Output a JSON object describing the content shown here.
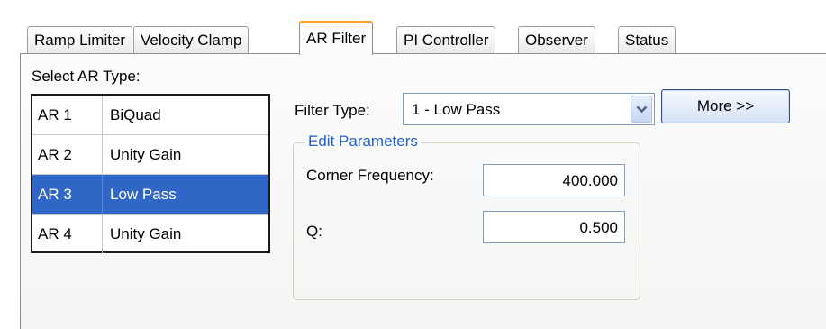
{
  "tabs": [
    {
      "label": "Ramp Limiter"
    },
    {
      "label": "Velocity Clamp"
    },
    {
      "label": "AR Filter"
    },
    {
      "label": "PI Controller"
    },
    {
      "label": "Observer"
    },
    {
      "label": "Status"
    }
  ],
  "active_tab": "AR Filter",
  "select_label": "Select AR Type:",
  "ar_list": {
    "rows": [
      {
        "id": "AR 1",
        "type": "BiQuad"
      },
      {
        "id": "AR 2",
        "type": "Unity Gain"
      },
      {
        "id": "AR 3",
        "type": "Low Pass"
      },
      {
        "id": "AR 4",
        "type": "Unity Gain"
      }
    ],
    "selected": "AR 3"
  },
  "filter_type": {
    "label": "Filter Type:",
    "value": "1 - Low Pass"
  },
  "more_button": {
    "label": "More >>"
  },
  "edit_parameters": {
    "title": "Edit Parameters",
    "corner_frequency_label": "Corner Frequency:",
    "corner_frequency_value": "400.000",
    "q_label": "Q:",
    "q_value": "0.500"
  },
  "colors": {
    "selection": "#3067c6",
    "active_tab_accent": "#f6a623",
    "group_title": "#1f5fcf"
  }
}
